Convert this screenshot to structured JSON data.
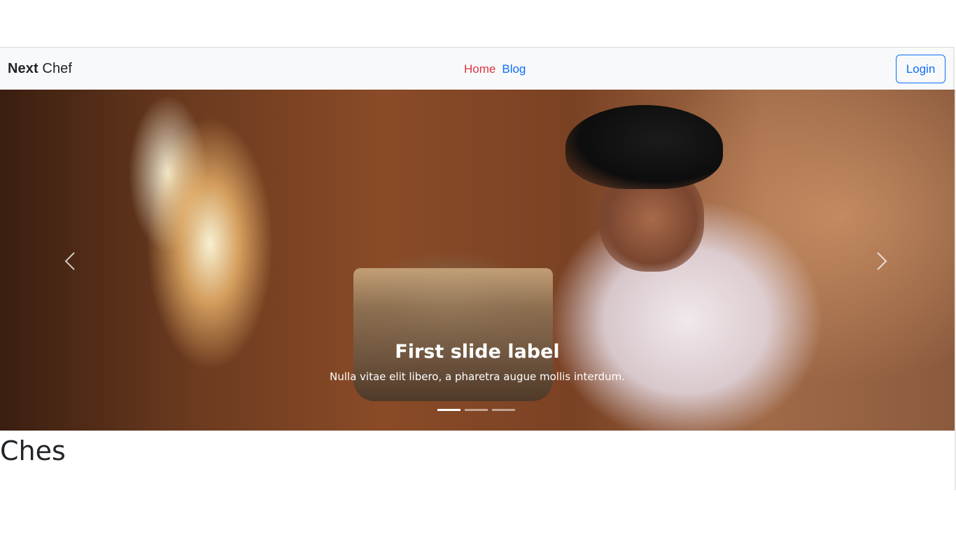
{
  "navbar": {
    "brand_bold": "Next",
    "brand_normal": " Chef",
    "links": [
      {
        "label": "Home",
        "color": "#dc3545"
      },
      {
        "label": "Blog",
        "color": "#0d6efd"
      }
    ],
    "login_label": "Login"
  },
  "carousel": {
    "slide": {
      "title": "First slide label",
      "text": "Nulla vitae elit libero, a pharetra augue mollis interdum."
    },
    "indicator_count": 3,
    "active_index": 0
  },
  "main": {
    "heading": "Ches"
  },
  "colors": {
    "primary": "#0d6efd",
    "danger": "#dc3545",
    "navbar_bg": "#f8f9fa",
    "text_dark": "#212529"
  },
  "icons": {
    "prev": "chevron-left-icon",
    "next": "chevron-right-icon"
  }
}
